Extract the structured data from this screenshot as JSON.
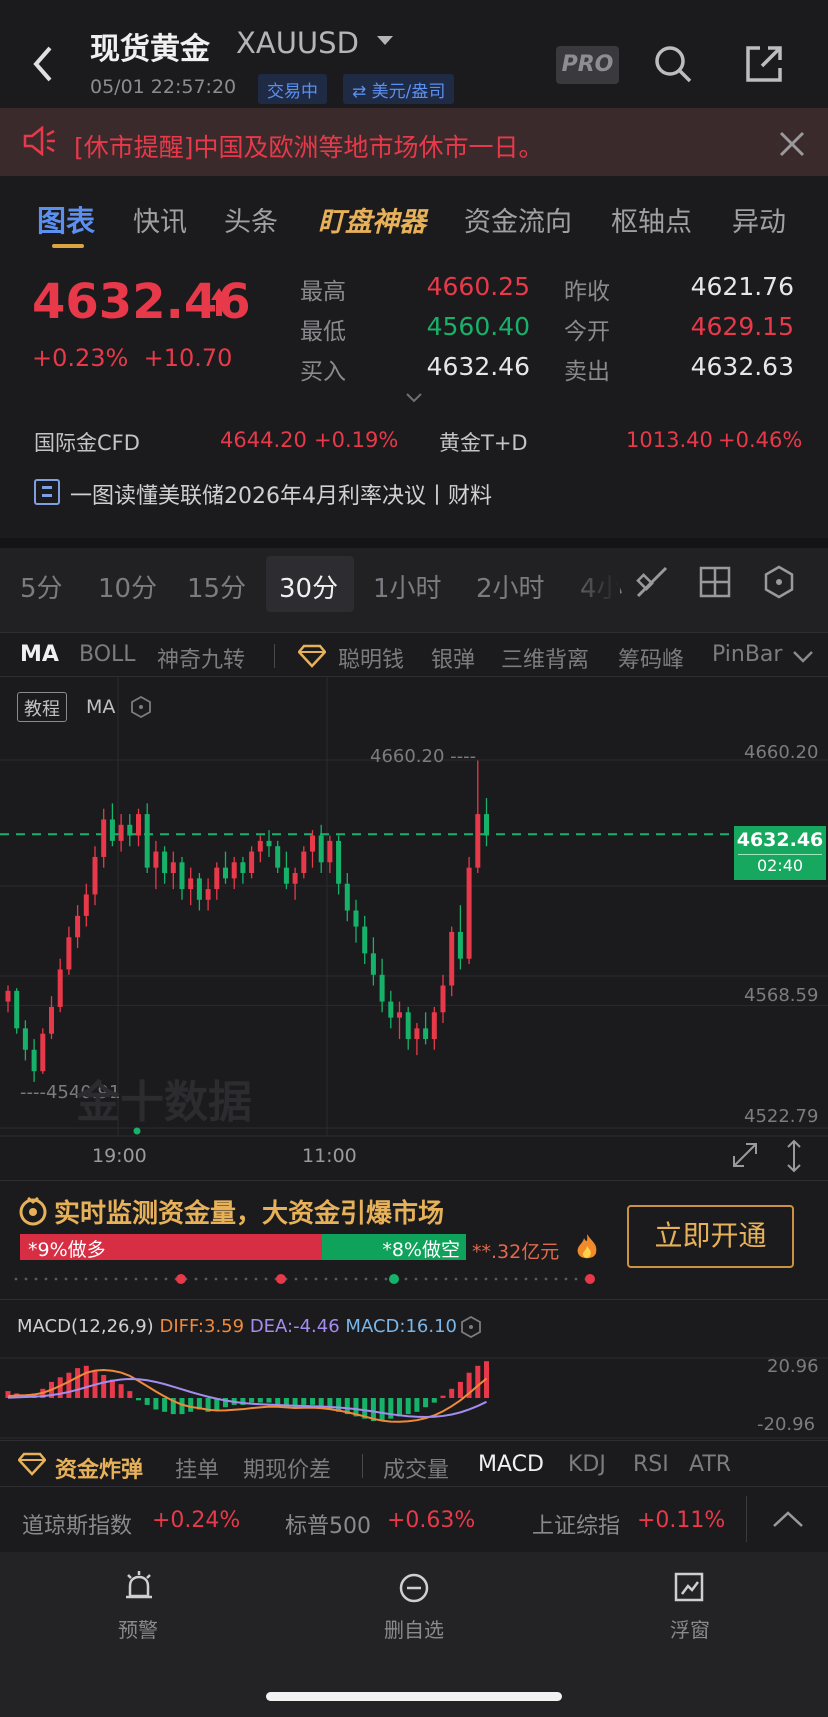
{
  "header": {
    "title": "现货黄金",
    "symbol": "XAUUSD",
    "datetime": "05/01 22:57:20",
    "status": "交易中",
    "currency": "⇄ 美元/盎司",
    "pro_label": "PRO"
  },
  "notice": {
    "text": "[休市提醒]中国及欧洲等地市场休市一日。"
  },
  "tabs": [
    {
      "label": "图表",
      "active": true
    },
    {
      "label": "快讯"
    },
    {
      "label": "头条"
    },
    {
      "label": "盯盘神器"
    },
    {
      "label": "资金流向"
    },
    {
      "label": "枢轴点"
    },
    {
      "label": "异动"
    }
  ],
  "quote": {
    "price": "4632.46",
    "change_pct": "+0.23%",
    "change_abs": "+10.70",
    "high_label": "最高",
    "high": "4660.25",
    "low_label": "最低",
    "low": "4560.40",
    "bid_label": "买入",
    "bid": "4632.46",
    "prev_close_label": "昨收",
    "prev_close": "4621.76",
    "open_label": "今开",
    "open": "4629.15",
    "ask_label": "卖出",
    "ask": "4632.63"
  },
  "related": [
    {
      "name": "国际金CFD",
      "price": "4644.20",
      "change": "+0.19%"
    },
    {
      "name": "黄金T+D",
      "price": "1013.40",
      "change": "+0.46%"
    }
  ],
  "news": {
    "text": "一图读懂美联储2026年4月利率决议丨财料"
  },
  "periods": [
    "5分",
    "10分",
    "15分",
    "30分",
    "1小时",
    "2小时",
    "4小"
  ],
  "selected_period": "30分",
  "indicators": [
    "MA",
    "BOLL",
    "神奇九转",
    "聪明钱",
    "银弹",
    "三维背离",
    "筹码峰",
    "PinBar"
  ],
  "chart": {
    "tutorial_label": "教程",
    "ma_label": "MA",
    "high_marker": "4660.20 ----",
    "low_marker": "----4540.91",
    "axis_labels": [
      "4660.20",
      "4568.59",
      "4522.79"
    ],
    "time_labels": [
      "19:00",
      "11:00"
    ],
    "current_price": "4632.46",
    "countdown": "02:40",
    "watermark": "金十数据"
  },
  "promo": {
    "title": "实时监测资金量，大资金引爆市场",
    "long_label": "*9%做多",
    "short_label": "*8%做空",
    "amount": "**.32亿元",
    "button": "立即开通"
  },
  "macd": {
    "name": "MACD(12,26,9)",
    "diff": "DIFF:3.59",
    "dea": "DEA:-4.46",
    "macd": "MACD:16.10",
    "axis_top": "20.96",
    "axis_bottom": "-20.96"
  },
  "bottom_tabs": [
    "资金炸弹",
    "挂单",
    "期现价差",
    "成交量",
    "MACD",
    "KDJ",
    "RSI",
    "ATR"
  ],
  "ticker": [
    {
      "name": "道琼斯指数",
      "change": "+0.24%"
    },
    {
      "name": "标普500",
      "change": "+0.63%"
    },
    {
      "name": "上证综指",
      "change": "+0.11%"
    }
  ],
  "nav": [
    {
      "label": "预警",
      "icon": "alarm-icon"
    },
    {
      "label": "删自选",
      "icon": "minus-circle-icon"
    },
    {
      "label": "浮窗",
      "icon": "float-window-icon"
    }
  ],
  "colors": {
    "up": "#e8394a",
    "down": "#17b26a",
    "accent": "#d9a441",
    "link": "#5b8ff0"
  },
  "candles": [
    [
      4570,
      4576,
      4566,
      4574
    ],
    [
      4574,
      4575,
      4558,
      4560
    ],
    [
      4560,
      4563,
      4548,
      4552
    ],
    [
      4552,
      4556,
      4540,
      4544
    ],
    [
      4544,
      4560,
      4543,
      4558
    ],
    [
      4558,
      4572,
      4556,
      4568
    ],
    [
      4568,
      4586,
      4566,
      4582
    ],
    [
      4582,
      4598,
      4580,
      4594
    ],
    [
      4594,
      4606,
      4590,
      4602
    ],
    [
      4602,
      4614,
      4598,
      4610
    ],
    [
      4610,
      4628,
      4606,
      4624
    ],
    [
      4624,
      4642,
      4620,
      4638
    ],
    [
      4638,
      4644,
      4628,
      4630
    ],
    [
      4630,
      4640,
      4626,
      4636
    ],
    [
      4636,
      4640,
      4628,
      4632
    ],
    [
      4632,
      4642,
      4628,
      4640
    ],
    [
      4640,
      4644,
      4618,
      4620
    ],
    [
      4620,
      4630,
      4612,
      4626
    ],
    [
      4626,
      4628,
      4614,
      4618
    ],
    [
      4618,
      4626,
      4612,
      4622
    ],
    [
      4622,
      4624,
      4608,
      4612
    ],
    [
      4612,
      4620,
      4606,
      4616
    ],
    [
      4616,
      4618,
      4604,
      4608
    ],
    [
      4608,
      4616,
      4604,
      4612
    ],
    [
      4612,
      4622,
      4608,
      4620
    ],
    [
      4620,
      4626,
      4614,
      4616
    ],
    [
      4616,
      4624,
      4612,
      4622
    ],
    [
      4622,
      4624,
      4614,
      4618
    ],
    [
      4618,
      4628,
      4616,
      4626
    ],
    [
      4626,
      4632,
      4622,
      4630
    ],
    [
      4630,
      4634,
      4624,
      4628
    ],
    [
      4628,
      4630,
      4618,
      4620
    ],
    [
      4620,
      4626,
      4612,
      4614
    ],
    [
      4614,
      4620,
      4608,
      4618
    ],
    [
      4618,
      4628,
      4616,
      4626
    ],
    [
      4626,
      4634,
      4620,
      4632
    ],
    [
      4632,
      4636,
      4618,
      4622
    ],
    [
      4622,
      4632,
      4618,
      4630
    ],
    [
      4630,
      4632,
      4610,
      4614
    ],
    [
      4614,
      4618,
      4600,
      4604
    ],
    [
      4604,
      4608,
      4592,
      4598
    ],
    [
      4598,
      4602,
      4584,
      4588
    ],
    [
      4588,
      4594,
      4576,
      4580
    ],
    [
      4580,
      4586,
      4566,
      4570
    ],
    [
      4570,
      4574,
      4560,
      4564
    ],
    [
      4564,
      4570,
      4556,
      4566
    ],
    [
      4566,
      4568,
      4552,
      4556
    ],
    [
      4556,
      4562,
      4550,
      4560
    ],
    [
      4560,
      4566,
      4554,
      4556
    ],
    [
      4556,
      4568,
      4552,
      4566
    ],
    [
      4566,
      4580,
      4562,
      4576
    ],
    [
      4576,
      4598,
      4572,
      4596
    ],
    [
      4596,
      4606,
      4582,
      4586
    ],
    [
      4586,
      4624,
      4584,
      4620
    ],
    [
      4620,
      4660,
      4618,
      4640
    ],
    [
      4640,
      4646,
      4628,
      4632
    ]
  ],
  "macd_bars": [
    3,
    2,
    1,
    2,
    4,
    7,
    9,
    11,
    13,
    14,
    12,
    10,
    8,
    6,
    3,
    -1,
    -3,
    -5,
    -6,
    -7,
    -7,
    -6,
    -5,
    -6,
    -5,
    -4,
    -3,
    -3,
    -2,
    -2,
    -2,
    -3,
    -4,
    -4,
    -3,
    -3,
    -4,
    -5,
    -6,
    -7,
    -8,
    -9,
    -10,
    -10,
    -9,
    -8,
    -7,
    -6,
    -4,
    -2,
    1,
    4,
    7,
    11,
    14,
    16
  ]
}
